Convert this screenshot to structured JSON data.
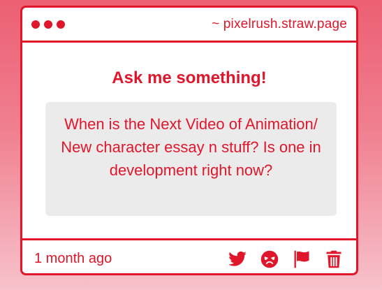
{
  "window": {
    "url": "~ pixelrush.straw.page",
    "dots": [
      "dot",
      "dot",
      "dot"
    ]
  },
  "main": {
    "heading": "Ask me something!",
    "question": "When is the Next Video of Animation/ New character essay n stuff? Is one in development right now?"
  },
  "footer": {
    "time": "1 month ago",
    "actions": [
      {
        "name": "twitter-share-button",
        "icon": "twitter-bird-icon"
      },
      {
        "name": "angry-react-button",
        "icon": "angry-face-icon"
      },
      {
        "name": "report-button",
        "icon": "flag-icon"
      },
      {
        "name": "delete-button",
        "icon": "trash-icon"
      }
    ]
  },
  "colors": {
    "accent": "#e0162b",
    "card_bg": "#ffffff",
    "question_bg": "#ecebec",
    "page_bg_top": "#ec5f73",
    "page_bg_bottom": "#f7c2cb"
  }
}
